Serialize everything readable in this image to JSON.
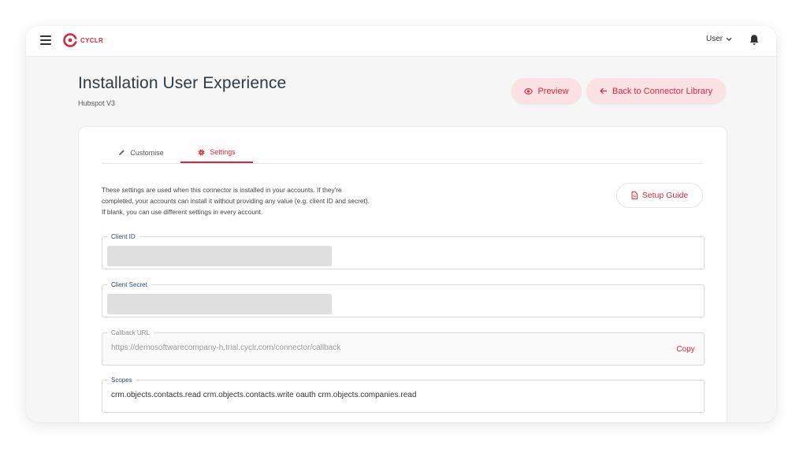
{
  "header": {
    "brand": "CYCLR",
    "user_label": "User"
  },
  "page": {
    "title": "Installation User Experience",
    "subtitle": "Hubspot V3"
  },
  "actions": {
    "preview_label": "Preview",
    "back_label": "Back to Connector Library"
  },
  "tabs": [
    {
      "label": "Customise",
      "icon": "pencil-icon",
      "active": false
    },
    {
      "label": "Settings",
      "icon": "gear-icon",
      "active": true
    }
  ],
  "settings": {
    "description": "These settings are used when this connector is installed in your accounts. If they're completed, your accounts can install it without providing any value (e.g. client ID and secret). If blank, you can use different settings in every account.",
    "setup_guide_label": "Setup Guide",
    "fields": {
      "client_id": {
        "label": "Client ID"
      },
      "client_secret": {
        "label": "Client Secret"
      },
      "callback_url": {
        "label": "Callback URL",
        "value": "https://demosoftwarecompany-h.trial.cyclr.com/connector/callback",
        "copy_label": "Copy"
      },
      "scopes": {
        "label": "Scopes",
        "value": "crm.objects.contacts.read crm.objects.contacts.write oauth crm.objects.companies.read"
      }
    }
  },
  "colors": {
    "accent": "#d5283c",
    "accent_soft": "#f9e1e4",
    "title": "#2f3a44"
  }
}
